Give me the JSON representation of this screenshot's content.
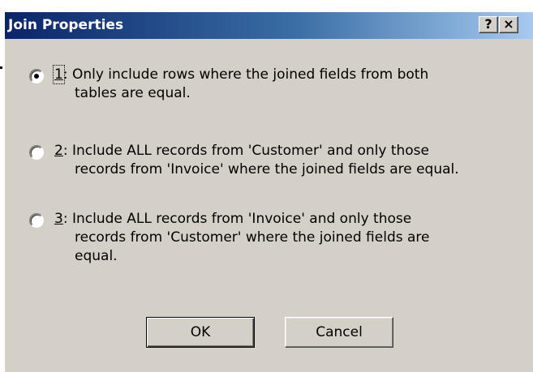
{
  "window": {
    "title": "Join Properties",
    "help_label": "?",
    "close_label": "×"
  },
  "options": [
    {
      "number": "1",
      "selected": true,
      "line1": "Only include rows where the joined fields from both",
      "line2": "tables are equal.",
      "line3": ""
    },
    {
      "number": "2",
      "selected": false,
      "line1": "Include ALL records from 'Customer' and only those",
      "line2": "records from 'Invoice' where the joined fields are equal.",
      "line3": ""
    },
    {
      "number": "3",
      "selected": false,
      "line1": "Include ALL records from 'Invoice' and only those",
      "line2": "records from 'Customer' where the joined fields are",
      "line3": "equal."
    }
  ],
  "buttons": {
    "ok_label": "OK",
    "cancel_label": "Cancel"
  }
}
